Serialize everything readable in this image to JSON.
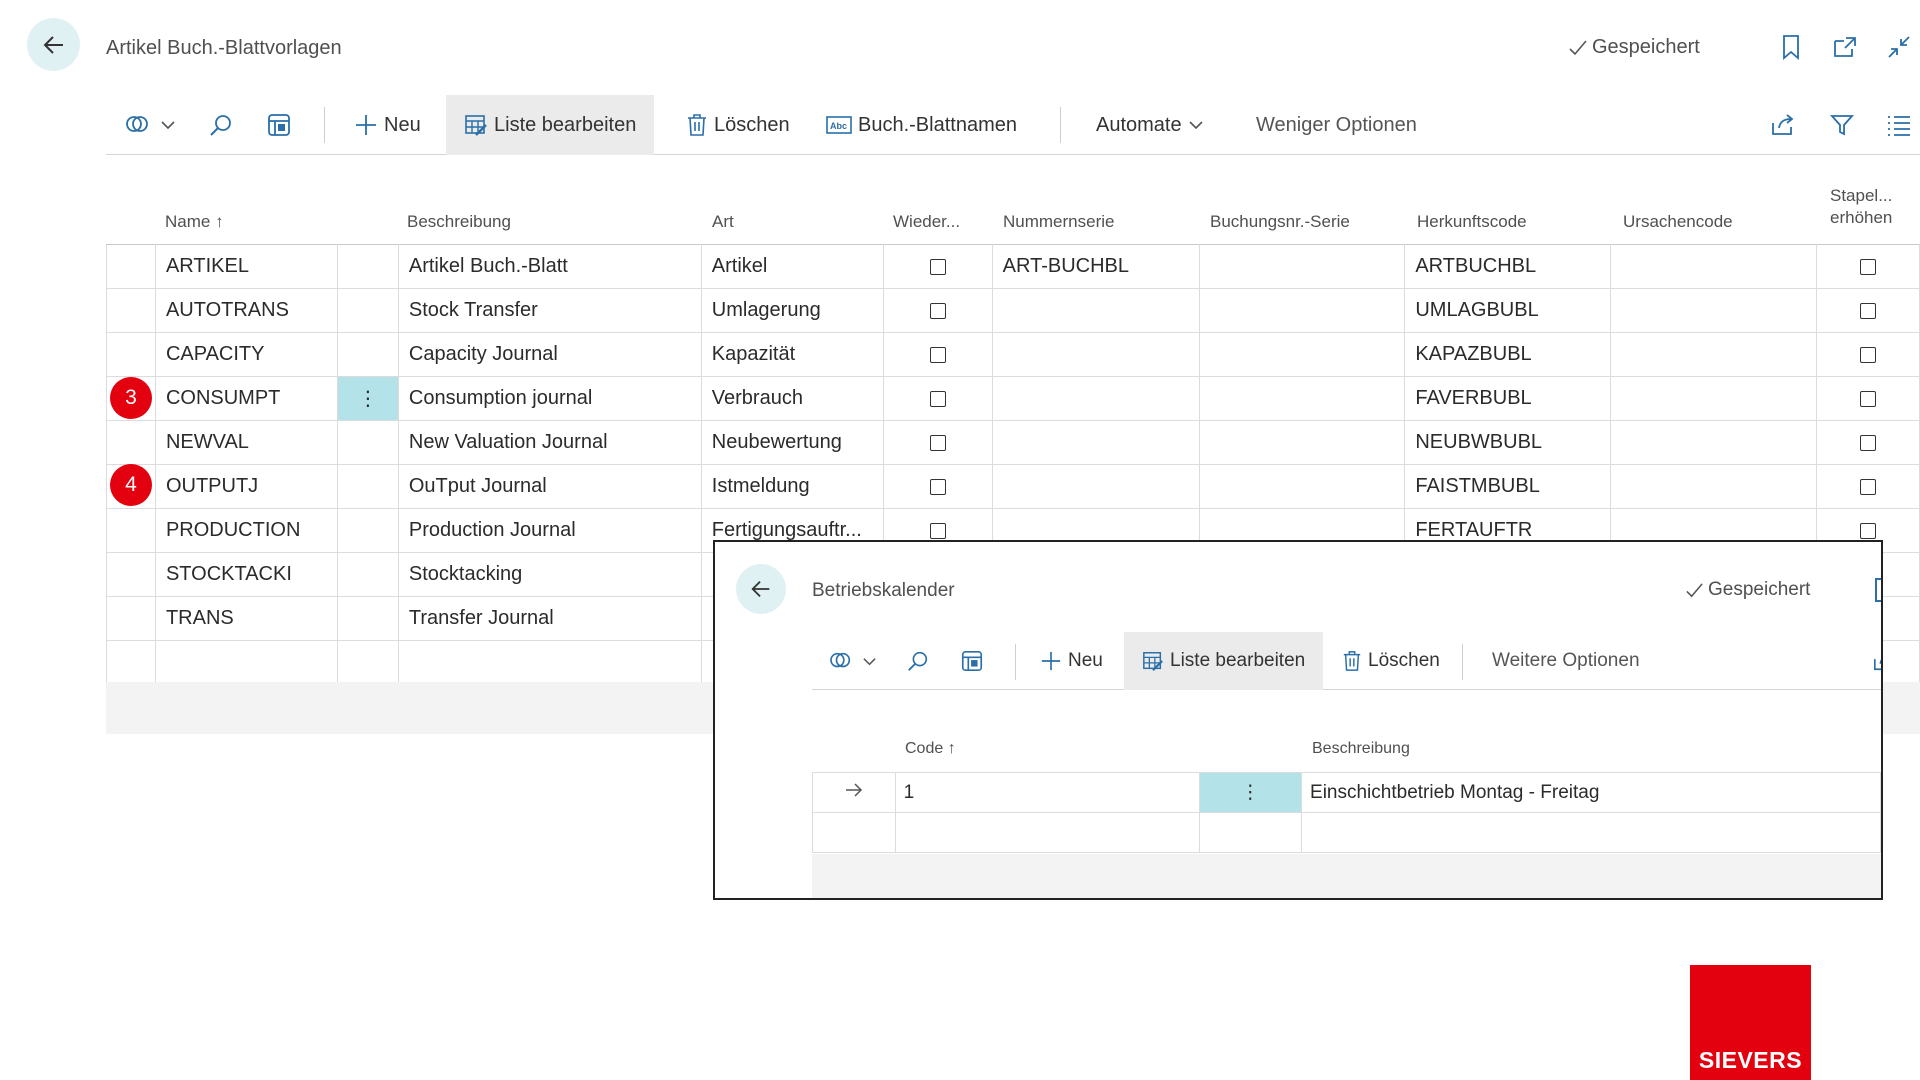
{
  "page": {
    "title": "Artikel Buch.-Blattvorlagen",
    "saved_label": "Gespeichert",
    "icons": [
      "back-arrow-icon",
      "bookmark-icon",
      "open-new-window-icon",
      "collapse-icon"
    ]
  },
  "actionbar": {
    "new_label": "Neu",
    "edit_list_label": "Liste bearbeiten",
    "delete_label": "Löschen",
    "journal_names_label": "Buch.-Blattnamen",
    "automate_label": "Automate",
    "fewer_options_label": "Weniger Optionen"
  },
  "grid": {
    "columns": {
      "name": "Name",
      "description": "Beschreibung",
      "type": "Art",
      "recurring": "Wieder...",
      "no_series": "Nummernserie",
      "posting_no_series": "Buchungsnr.-Serie",
      "source_code": "Herkunftscode",
      "reason_code": "Ursachencode",
      "increment_batch_line1": "Stapel...",
      "increment_batch_line2": "erhöhen"
    },
    "rows": [
      {
        "name": "ARTIKEL",
        "description": "Artikel Buch.-Blatt",
        "type": "Artikel",
        "no_series": "ART-BUCHBL",
        "source_code": "ARTBUCHBL"
      },
      {
        "name": "AUTOTRANS",
        "description": "Stock Transfer",
        "type": "Umlagerung",
        "no_series": "",
        "source_code": "UMLAGBUBL"
      },
      {
        "name": "CAPACITY",
        "description": "Capacity Journal",
        "type": "Kapazität",
        "no_series": "",
        "source_code": "KAPAZBUBL"
      },
      {
        "name": "CONSUMPT",
        "description": "Consumption journal",
        "type": "Verbrauch",
        "no_series": "",
        "source_code": "FAVERBUBL"
      },
      {
        "name": "NEWVAL",
        "description": "New Valuation Journal",
        "type": "Neubewertung",
        "no_series": "",
        "source_code": "NEUBWBUBL"
      },
      {
        "name": "OUTPUTJ",
        "description": "OuTput Journal",
        "type": "Istmeldung",
        "no_series": "",
        "source_code": "FAISTMBUBL"
      },
      {
        "name": "PRODUCTION",
        "description": "Production Journal",
        "type": "Fertigungsauftr...",
        "no_series": "",
        "source_code": "FERTAUFTR"
      },
      {
        "name": "STOCKTACKI",
        "description": "Stocktacking",
        "type": "",
        "no_series": "",
        "source_code": ""
      },
      {
        "name": "TRANS",
        "description": "Transfer Journal",
        "type": "",
        "no_series": "",
        "source_code": ""
      }
    ]
  },
  "badges": [
    {
      "number": "3"
    },
    {
      "number": "4"
    }
  ],
  "dialog": {
    "title": "Betriebskalender",
    "saved_label": "Gespeichert",
    "new_label": "Neu",
    "edit_list_label": "Liste bearbeiten",
    "delete_label": "Löschen",
    "more_options_label": "Weitere Optionen",
    "columns": {
      "code": "Code",
      "description": "Beschreibung"
    },
    "rows": [
      {
        "code": "1",
        "description": "Einschichtbetrieb Montag - Freitag"
      }
    ]
  },
  "logo": {
    "text": "SIEVERS"
  },
  "colors": {
    "accent_teal": "#b3e3e8",
    "badge_red": "#e3000f",
    "back_btn_bg": "#dff1f3"
  }
}
